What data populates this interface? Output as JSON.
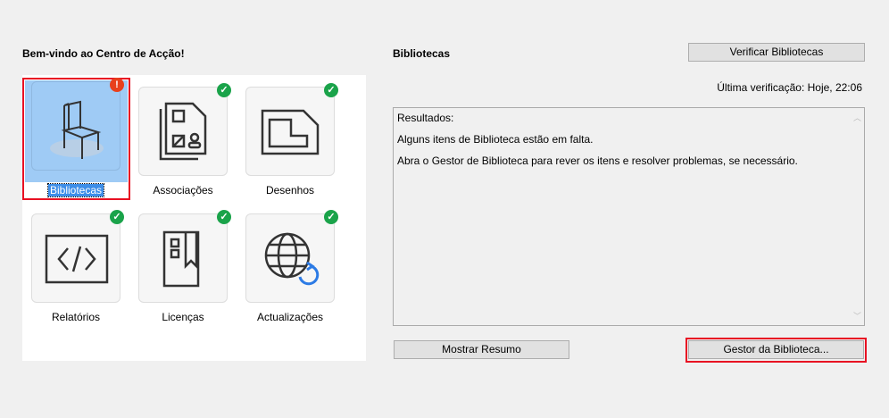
{
  "left": {
    "title": "Bem-vindo ao Centro de Acção!",
    "tiles": [
      {
        "label": "Bibliotecas",
        "status": "error",
        "icon": "chair-icon"
      },
      {
        "label": "Associações",
        "status": "ok",
        "icon": "documents-icon"
      },
      {
        "label": "Desenhos",
        "status": "ok",
        "icon": "drawing-icon"
      },
      {
        "label": "Relatórios",
        "status": "ok",
        "icon": "code-icon"
      },
      {
        "label": "Licenças",
        "status": "ok",
        "icon": "license-icon"
      },
      {
        "label": "Actualizações",
        "status": "ok",
        "icon": "globe-update-icon"
      }
    ],
    "badge_ok": "✓",
    "badge_error": "!"
  },
  "right": {
    "title": "Bibliotecas",
    "verify_button": "Verificar Bibliotecas",
    "last_check": "Última verificação: Hoje, 22:06",
    "results": [
      "Resultados:",
      "Alguns itens de Biblioteca estão em falta.",
      "Abra o Gestor de Biblioteca para rever os itens e resolver problemas, se necessário."
    ],
    "summary_button": "Mostrar Resumo",
    "manager_button": "Gestor da Biblioteca..."
  },
  "colors": {
    "accent_error": "#e81123",
    "ok": "#1aa34a",
    "selection": "#9fcbf5"
  }
}
